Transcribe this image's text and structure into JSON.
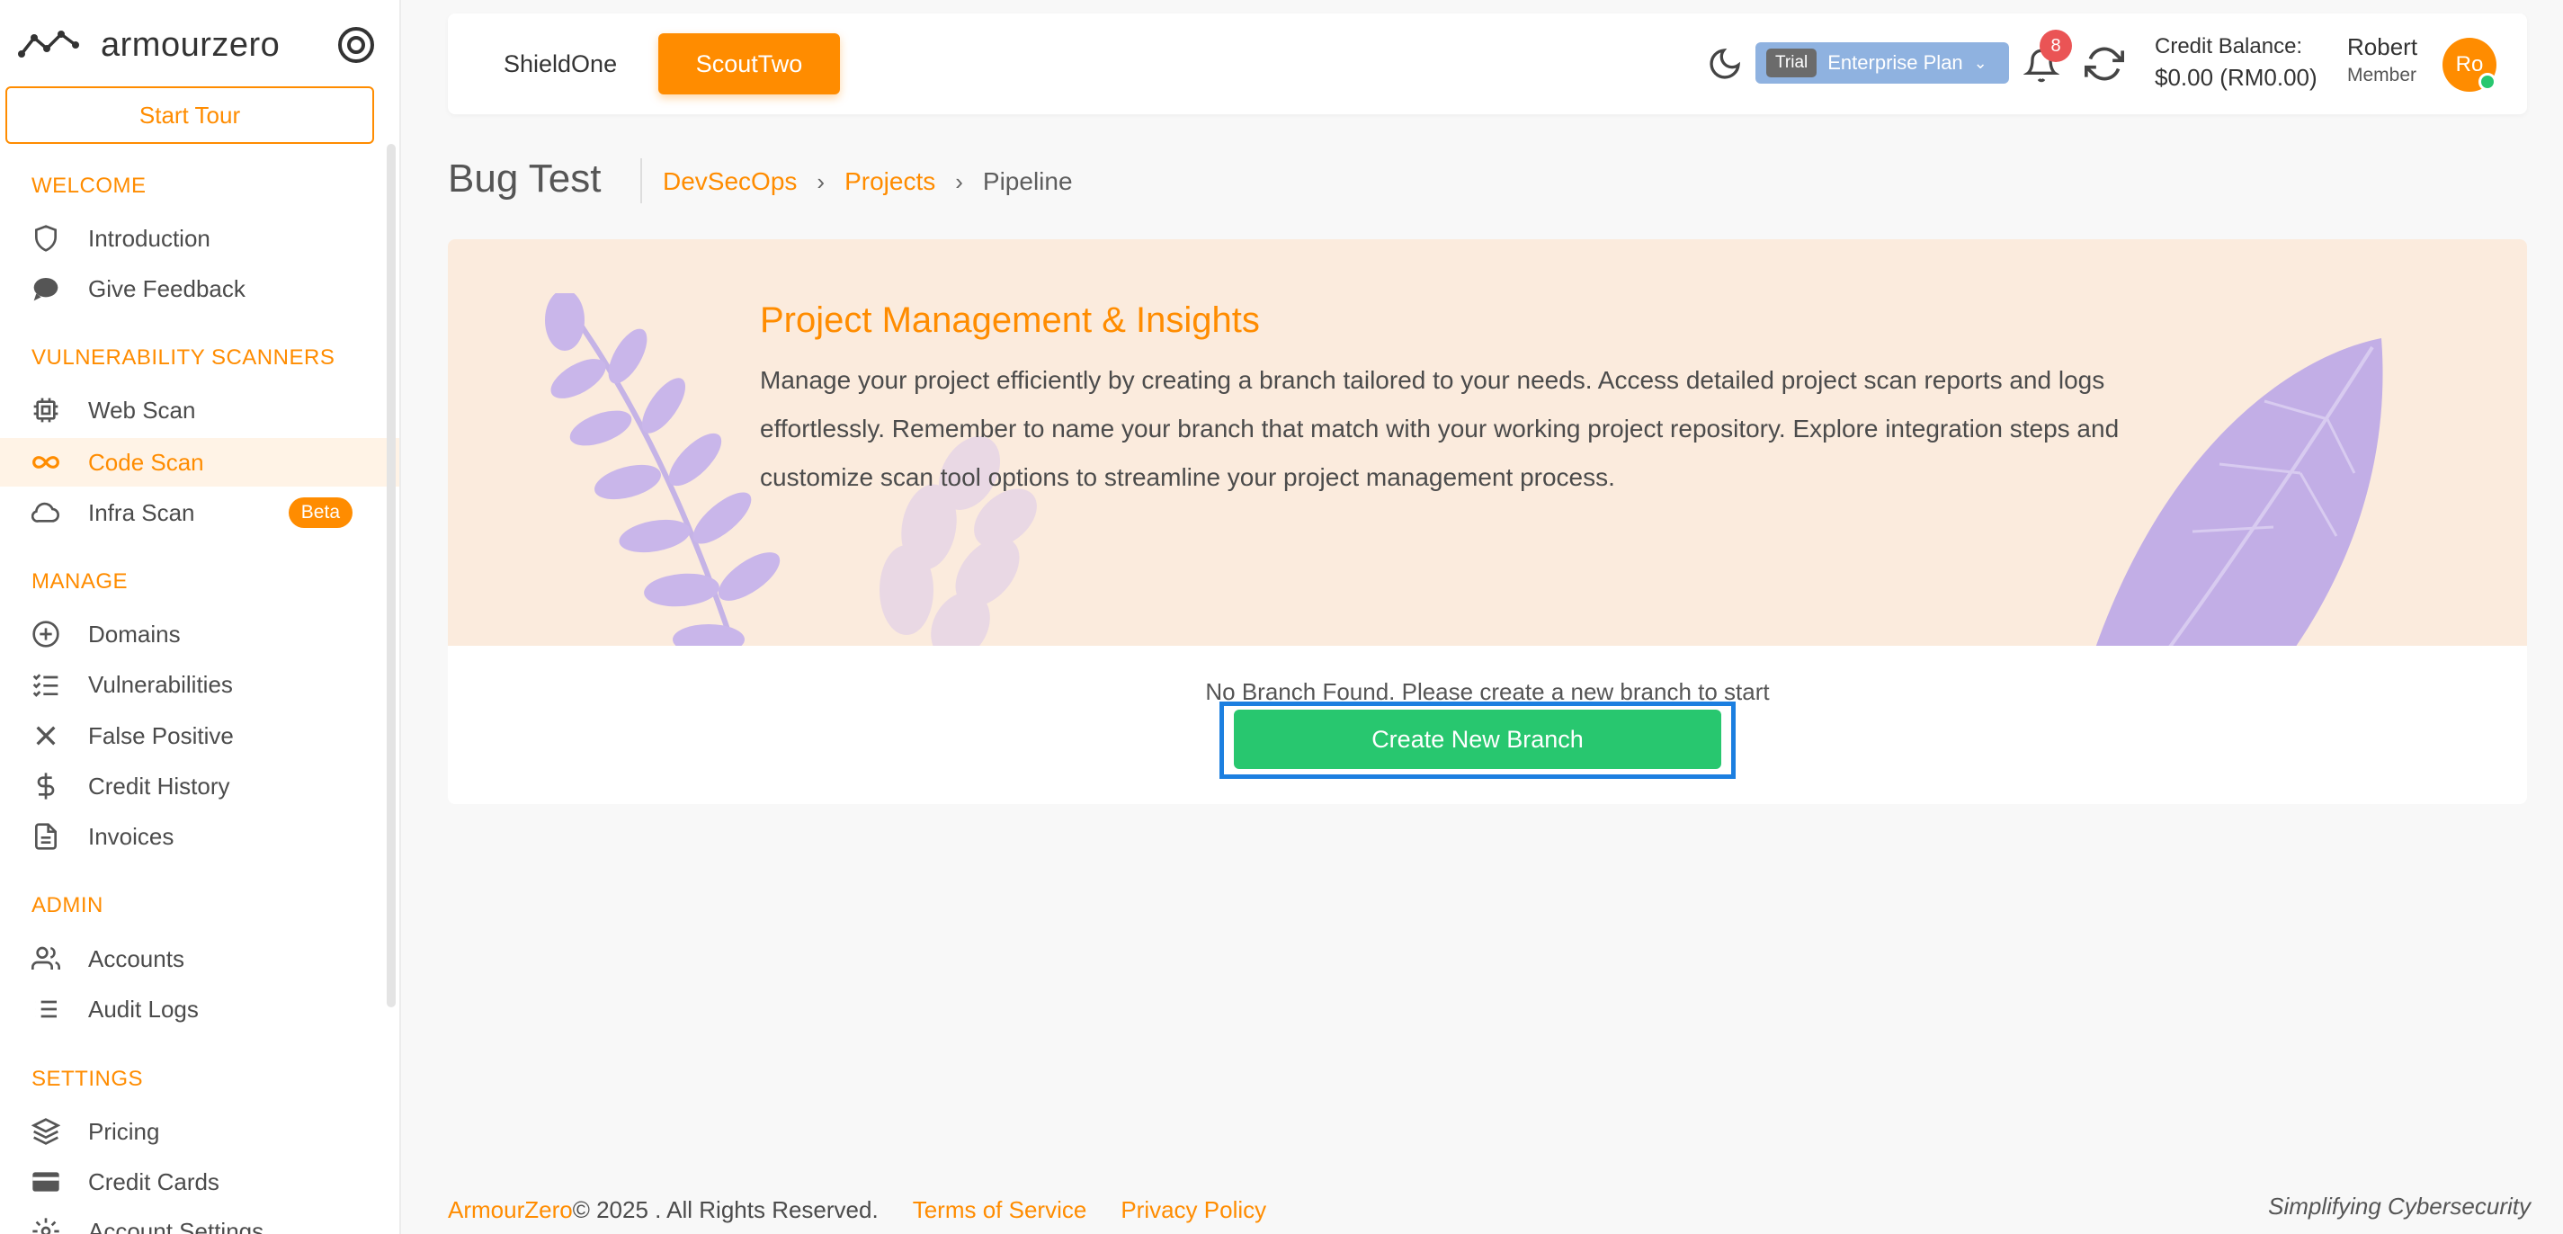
{
  "sidebar": {
    "logo_text": "armourzero",
    "tour_label": "Start Tour",
    "sections": {
      "welcome": "WELCOME",
      "scanners": "VULNERABILITY SCANNERS",
      "manage": "MANAGE",
      "admin": "ADMIN",
      "settings": "SETTINGS"
    },
    "items": {
      "introduction": {
        "label": "Introduction",
        "icon": "shield-icon"
      },
      "feedback": {
        "label": "Give Feedback",
        "icon": "chat-icon"
      },
      "web_scan": {
        "label": "Web Scan",
        "icon": "chip-icon"
      },
      "code_scan": {
        "label": "Code Scan",
        "icon": "infinity-icon"
      },
      "infra_scan": {
        "label": "Infra Scan",
        "icon": "cloud-icon",
        "badge": "Beta"
      },
      "domains": {
        "label": "Domains",
        "icon": "plus-circle-icon"
      },
      "vulnerabilities": {
        "label": "Vulnerabilities",
        "icon": "list-check-icon"
      },
      "false_positive": {
        "label": "False Positive",
        "icon": "x-icon"
      },
      "credit_history": {
        "label": "Credit History",
        "icon": "dollar-icon"
      },
      "invoices": {
        "label": "Invoices",
        "icon": "file-icon"
      },
      "accounts": {
        "label": "Accounts",
        "icon": "users-icon"
      },
      "audit_logs": {
        "label": "Audit Logs",
        "icon": "list-icon"
      },
      "pricing": {
        "label": "Pricing",
        "icon": "layers-icon"
      },
      "credit_cards": {
        "label": "Credit Cards",
        "icon": "credit-card-icon"
      },
      "account_settings": {
        "label": "Account Settings",
        "icon": "gear-icon"
      }
    },
    "active_item": "Code Scan"
  },
  "header": {
    "tabs": [
      "ShieldOne",
      "ScoutTwo"
    ],
    "active_tab": "ScoutTwo",
    "plan_badge": "Trial",
    "plan_name": "Enterprise Plan",
    "notification_count": "8",
    "credit_label": "Credit Balance:",
    "credit_value": "$0.00 (RM0.00)",
    "user_name": "Robert",
    "user_role": "Member",
    "avatar_initials": "Ro"
  },
  "breadcrumb": {
    "title": "Bug Test",
    "items": [
      "DevSecOps",
      "Projects",
      "Pipeline"
    ]
  },
  "banner": {
    "title": "Project Management & Insights",
    "text": "Manage your project efficiently by creating a branch tailored to your needs. Access detailed project scan reports and logs effortlessly. Remember to name your branch that match with your working project repository. Explore integration steps and customize scan tool options to streamline your project management process."
  },
  "empty_state": {
    "message": "No Branch Found. Please create a new branch to start",
    "button": "Create New Branch"
  },
  "footer": {
    "brand": "ArmourZero",
    "copyright": " © 2025 . All Rights Reserved.",
    "terms": "Terms of Service",
    "privacy": "Privacy Policy",
    "tagline": "Simplifying Cybersecurity"
  },
  "colors": {
    "accent": "#ff8c00",
    "success": "#28c76f",
    "banner_bg": "#fbebdd",
    "focus": "#1c7fe0"
  }
}
